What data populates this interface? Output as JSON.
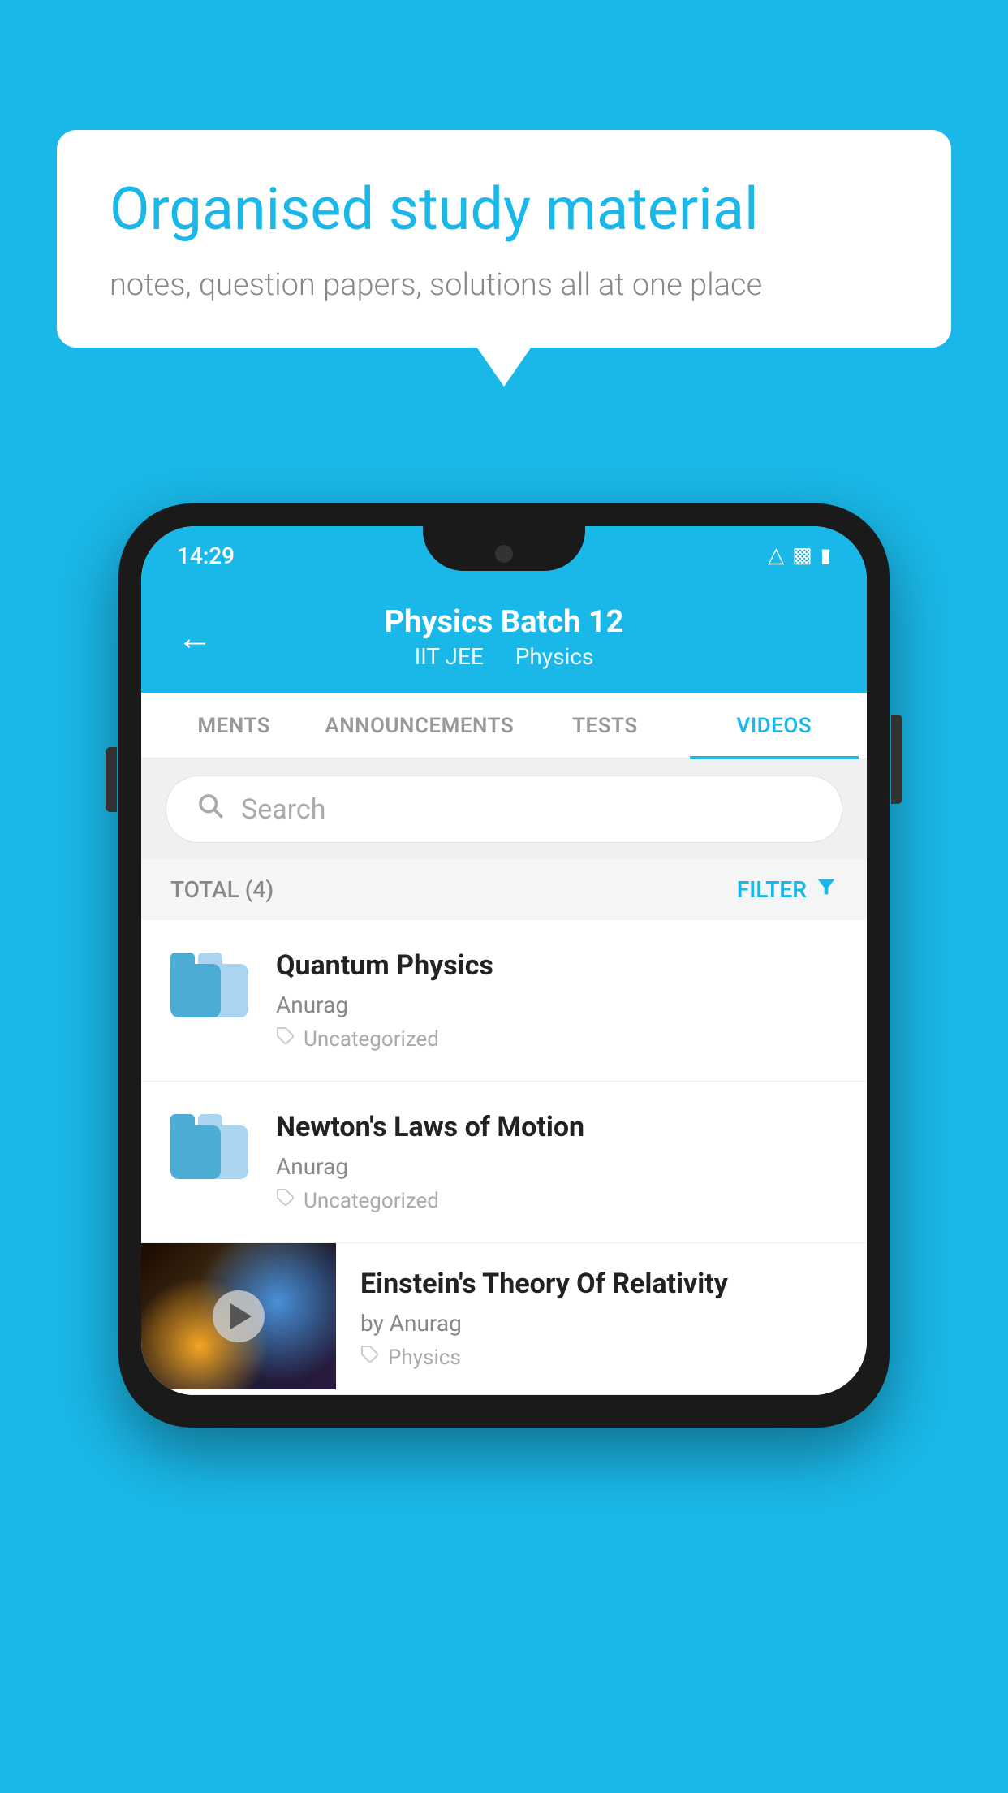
{
  "background_color": "#1ab8e8",
  "speech_bubble": {
    "title": "Organised study material",
    "subtitle": "notes, question papers, solutions all at one place"
  },
  "phone": {
    "status_bar": {
      "time": "14:29"
    },
    "header": {
      "title": "Physics Batch 12",
      "subtitle1": "IIT JEE",
      "subtitle2": "Physics",
      "back_label": "←"
    },
    "tabs": [
      {
        "label": "MENTS",
        "active": false
      },
      {
        "label": "ANNOUNCEMENTS",
        "active": false
      },
      {
        "label": "TESTS",
        "active": false
      },
      {
        "label": "VIDEOS",
        "active": true
      }
    ],
    "search": {
      "placeholder": "Search"
    },
    "filter_bar": {
      "total": "TOTAL (4)",
      "filter_label": "FILTER"
    },
    "videos": [
      {
        "title": "Quantum Physics",
        "author": "Anurag",
        "tag": "Uncategorized",
        "has_thumbnail": false
      },
      {
        "title": "Newton's Laws of Motion",
        "author": "Anurag",
        "tag": "Uncategorized",
        "has_thumbnail": false
      },
      {
        "title": "Einstein's Theory Of Relativity",
        "author": "by Anurag",
        "tag": "Physics",
        "has_thumbnail": true
      }
    ]
  }
}
